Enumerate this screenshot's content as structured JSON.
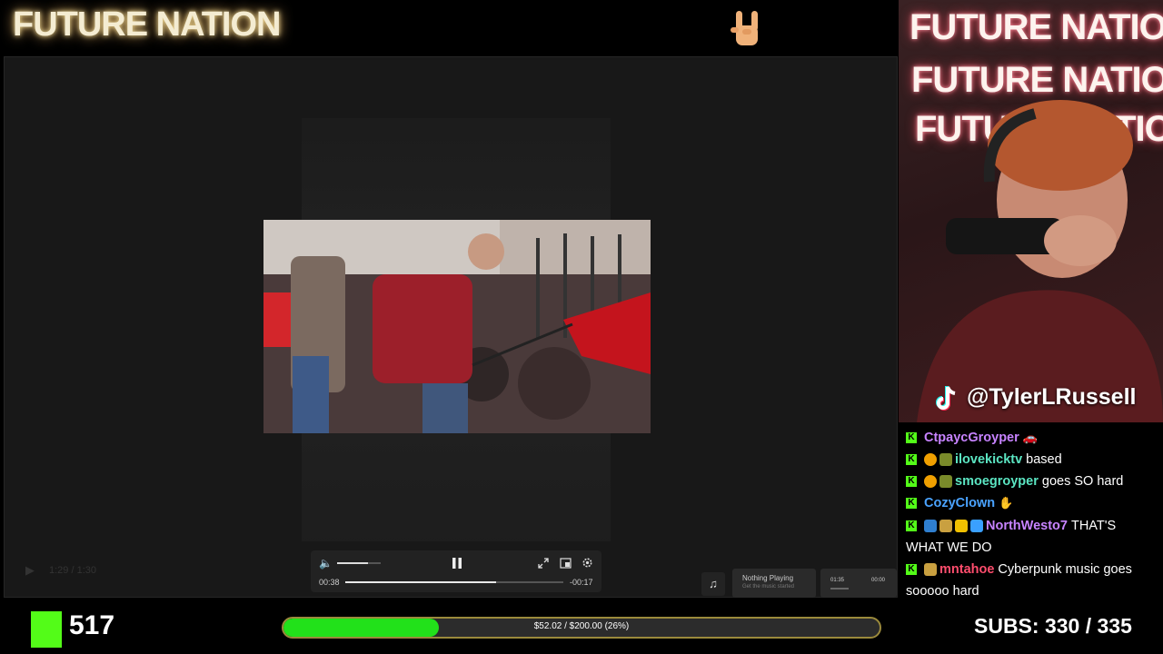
{
  "header": {
    "logo_text": "FUTURE NATION",
    "rock_icon": "rock-hand-icon"
  },
  "webcam": {
    "overlay_lines": [
      "FUTURE NATION",
      "FUTURE NATION",
      "FUTURE NATION"
    ],
    "tiktok_handle": "@TylerLRussell",
    "tiktok_icon": "tiktok-icon"
  },
  "stage": {
    "ghost_time": "1:29 / 1:30"
  },
  "player": {
    "elapsed": "00:38",
    "remaining": "-00:17",
    "progress": 0.69,
    "volume_level": 0.7,
    "icons": [
      "volume-icon",
      "pause-icon",
      "fullscreen-icon",
      "pip-icon",
      "settings-icon"
    ]
  },
  "music": {
    "title": "Nothing Playing",
    "subtitle": "Get the music started",
    "time_start": "01:35",
    "time_end": "00:00"
  },
  "chat": [
    {
      "user": "CtpaycGroyper",
      "color": "#c783ff",
      "badges": [],
      "message": "",
      "trail": "car-emote"
    },
    {
      "user": "ilovekicktv",
      "color": "#5be5c2",
      "badges": [
        "#f0a000",
        "#7a8b2a"
      ],
      "message": "based"
    },
    {
      "user": "smoegroyper",
      "color": "#5be5c2",
      "badges": [
        "#f0a000",
        "#7a8b2a"
      ],
      "message": "goes SO hard"
    },
    {
      "user": "CozyClown",
      "color": "#4aa3ff",
      "badges": [],
      "message": "",
      "trail": "emote"
    },
    {
      "user": "NorthWesto7",
      "color": "#c783ff",
      "badges": [
        "#2f7fd0",
        "#c9a040",
        "#f0c000",
        "#3aa0ff"
      ],
      "message": "THAT'S WHAT WE DO",
      "wrap1": "THAT'S",
      "wrap2": "WHAT WE DO"
    },
    {
      "user": "mntahoe",
      "color": "#ff4d6d",
      "badges": [
        "#c9a040"
      ],
      "message": "Cyberpunk music goes soooo hard",
      "wrap1": "Cyberpunk music goes",
      "wrap2": "sooooo hard"
    }
  ],
  "footer": {
    "viewer_count": "517",
    "goal_text": "$52.02 / $200.00 (26%)",
    "goal_fraction": 0.26,
    "subs_text": "SUBS:  330 / 335",
    "kick_logo": "kick-logo-icon"
  },
  "colors": {
    "kick_green": "#53fc18",
    "goal_green": "#22e11a"
  }
}
